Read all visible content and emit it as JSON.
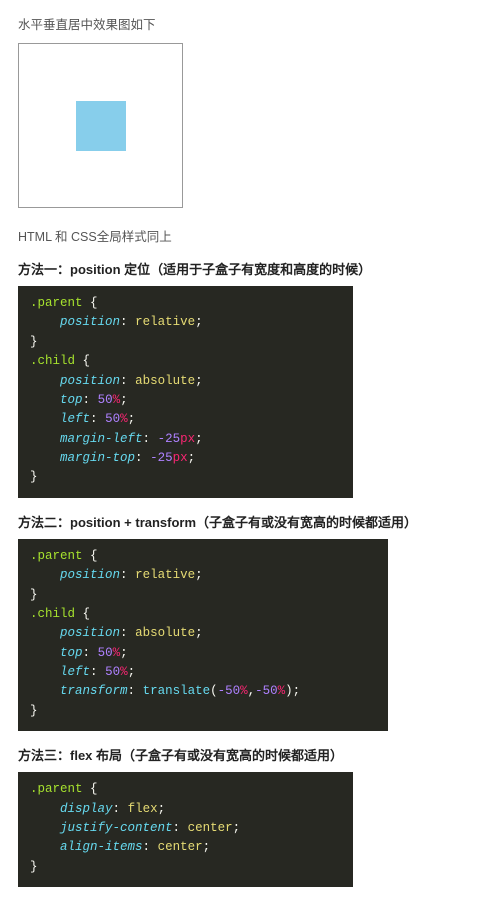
{
  "caption": "水平垂直居中效果图如下",
  "note": "HTML 和 CSS全局样式同上",
  "methods": [
    {
      "title": "方法一：position 定位（适用于子盒子有宽度和高度的时候）",
      "code": {
        "sel1": ".parent",
        "l1_prop": "position",
        "l1_val": "relative",
        "sel2": ".child",
        "l2_prop": "position",
        "l2_val": "absolute",
        "l3_prop": "top",
        "l3_num": "50",
        "l3_unit": "%",
        "l4_prop": "left",
        "l4_num": "50",
        "l4_unit": "%",
        "l5_prop": "margin-left",
        "l5_num": "-25",
        "l5_unit": "px",
        "l6_prop": "margin-top",
        "l6_num": "-25",
        "l6_unit": "px"
      }
    },
    {
      "title": "方法二：position + transform（子盒子有或没有宽高的时候都适用）",
      "code": {
        "sel1": ".parent",
        "l1_prop": "position",
        "l1_val": "relative",
        "sel2": ".child",
        "l2_prop": "position",
        "l2_val": "absolute",
        "l3_prop": "top",
        "l3_num": "50",
        "l3_unit": "%",
        "l4_prop": "left",
        "l4_num": "50",
        "l4_unit": "%",
        "l5_prop": "transform",
        "l5_fn": "translate",
        "l5_a": "-50",
        "l5_au": "%",
        "l5_b": "-50",
        "l5_bu": "%"
      }
    },
    {
      "title": "方法三：flex 布局（子盒子有或没有宽高的时候都适用）",
      "code": {
        "sel1": ".parent",
        "l1_prop": "display",
        "l1_val": "flex",
        "l2_prop": "justify-content",
        "l2_val": "center",
        "l3_prop": "align-items",
        "l3_val": "center"
      }
    }
  ]
}
